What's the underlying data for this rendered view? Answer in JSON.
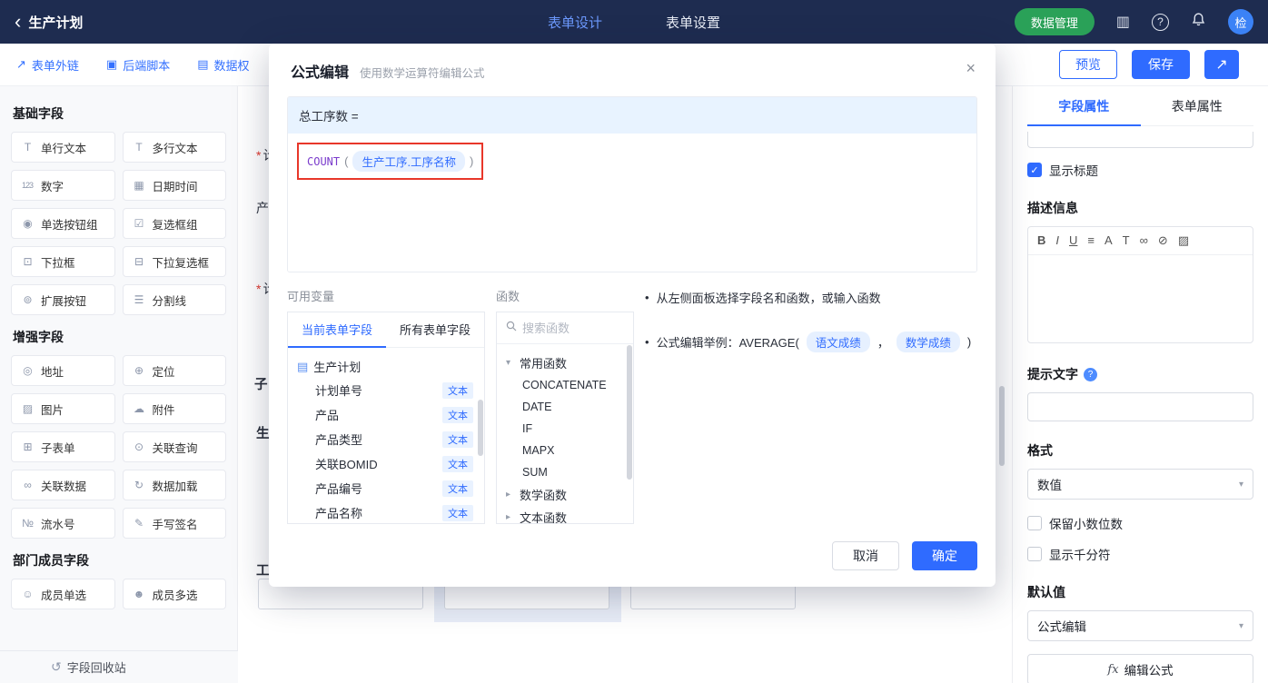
{
  "topbar": {
    "back_icon": "‹",
    "title": "生产计划",
    "nav": [
      {
        "label": "表单设计"
      },
      {
        "label": "表单设置"
      }
    ],
    "data_manage": "数据管理",
    "icons": {
      "apps": "▥",
      "help": "?",
      "avatar": "检"
    }
  },
  "toolbar": {
    "links": [
      {
        "icon": "↗",
        "label": "表单外链"
      },
      {
        "icon": "▣",
        "label": "后端脚本"
      },
      {
        "icon": "▤",
        "label": "数据权"
      }
    ],
    "preview": "预览",
    "save": "保存",
    "share_icon": "↗"
  },
  "palette": {
    "sections": [
      {
        "title": "基础字段",
        "items": [
          {
            "icon": "T",
            "label": "单行文本"
          },
          {
            "icon": "T",
            "label": "多行文本"
          },
          {
            "icon": "123",
            "label": "数字"
          },
          {
            "icon": "▦",
            "label": "日期时间"
          },
          {
            "icon": "◉",
            "label": "单选按钮组"
          },
          {
            "icon": "☑",
            "label": "复选框组"
          },
          {
            "icon": "⊡",
            "label": "下拉框"
          },
          {
            "icon": "⊟",
            "label": "下拉复选框"
          },
          {
            "icon": "⊚",
            "label": "扩展按钮"
          },
          {
            "icon": "☰",
            "label": "分割线"
          }
        ]
      },
      {
        "title": "增强字段",
        "items": [
          {
            "icon": "◎",
            "label": "地址"
          },
          {
            "icon": "⊕",
            "label": "定位"
          },
          {
            "icon": "▨",
            "label": "图片"
          },
          {
            "icon": "☁",
            "label": "附件"
          },
          {
            "icon": "⊞",
            "label": "子表单"
          },
          {
            "icon": "⊙",
            "label": "关联查询"
          },
          {
            "icon": "∞",
            "label": "关联数据"
          },
          {
            "icon": "↻",
            "label": "数据加载"
          },
          {
            "icon": "№",
            "label": "流水号"
          },
          {
            "icon": "✎",
            "label": "手写签名"
          }
        ]
      },
      {
        "title": "部门成员字段",
        "items": [
          {
            "icon": "☺",
            "label": "成员单选"
          },
          {
            "icon": "☻",
            "label": "成员多选"
          }
        ]
      }
    ],
    "recycle": {
      "icon": "↺",
      "label": "字段回收站"
    }
  },
  "canvas": {
    "star": "*",
    "frag1": "计",
    "frag2": "产",
    "frag3": "计",
    "frag4": "子",
    "frag5": "生",
    "frag6": "工"
  },
  "modal": {
    "title": "公式编辑",
    "subtitle": "使用数学运算符编辑公式",
    "close_icon": "×",
    "target": "总工序数 =",
    "formula": {
      "fn": "COUNT",
      "open": "(",
      "field": "生产工序.工序名称",
      "close": ")"
    },
    "vars": {
      "title": "可用变量",
      "tabs": [
        {
          "label": "当前表单字段"
        },
        {
          "label": "所有表单字段"
        }
      ],
      "root_icon": "▤",
      "root": "生产计划",
      "fields": [
        {
          "name": "计划单号",
          "tag": "文本"
        },
        {
          "name": "产品",
          "tag": "文本"
        },
        {
          "name": "产品类型",
          "tag": "文本"
        },
        {
          "name": "关联BOMID",
          "tag": "文本"
        },
        {
          "name": "产品编号",
          "tag": "文本"
        },
        {
          "name": "产品名称",
          "tag": "文本"
        }
      ]
    },
    "funcs": {
      "title": "函数",
      "search_placeholder": "搜索函数",
      "groups": [
        {
          "chev": "▾",
          "label": "常用函数"
        },
        {
          "chev": "▸",
          "label": "数学函数"
        },
        {
          "chev": "▸",
          "label": "文本函数"
        }
      ],
      "common_items": [
        "CONCATENATE",
        "DATE",
        "IF",
        "MAPX",
        "SUM"
      ]
    },
    "help": {
      "bullet": "•",
      "line1": "从左侧面板选择字段名和函数，或输入函数",
      "line2_prefix": "公式编辑举例：AVERAGE(",
      "pill1": "语文成绩",
      "sep": "，",
      "pill2": "数学成绩",
      "line2_suffix": ")"
    },
    "cancel": "取消",
    "ok": "确定"
  },
  "props": {
    "tabs": [
      {
        "label": "字段属性"
      },
      {
        "label": "表单属性"
      }
    ],
    "show_title": "显示标题",
    "check_icon": "✓",
    "desc_label": "描述信息",
    "rte": [
      "B",
      "I",
      "U",
      "≡",
      "A",
      "T",
      "∞",
      "⊘",
      "▨"
    ],
    "hint_label": "提示文字",
    "help_icon": "?",
    "format_label": "格式",
    "format_value": "数值",
    "chevron": "▾",
    "keep_decimal": "保留小数位数",
    "thousand": "显示千分符",
    "default_label": "默认值",
    "default_value": "公式编辑",
    "fx": "fx",
    "edit_formula": "编辑公式"
  }
}
